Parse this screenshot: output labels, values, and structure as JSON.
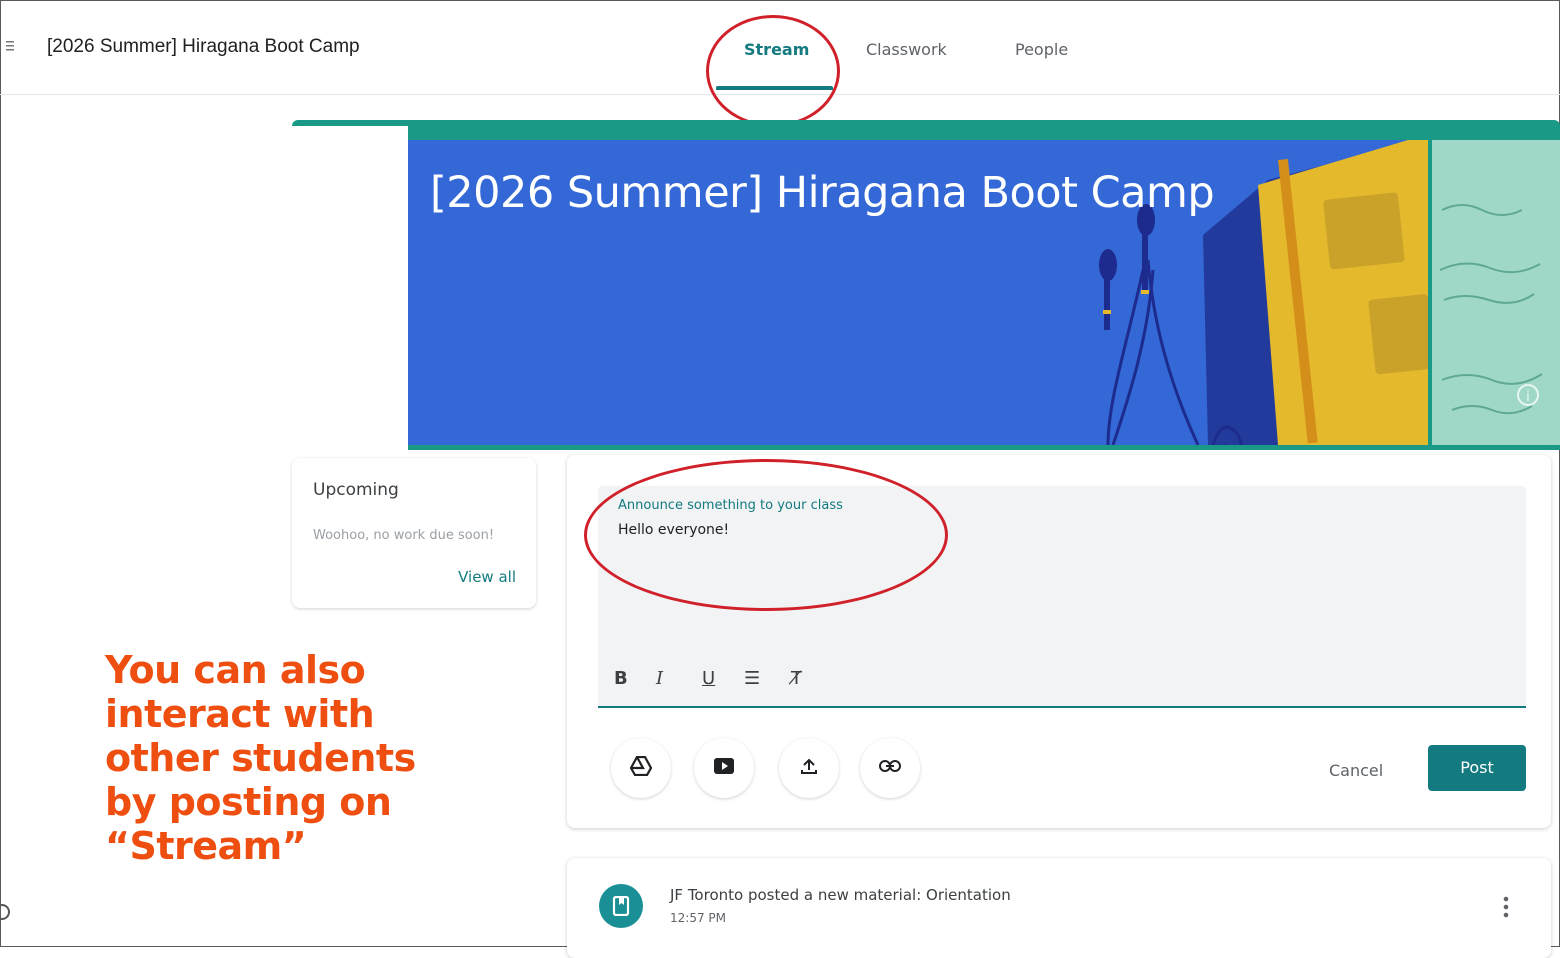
{
  "app": {
    "course_title": "[2026 Summer] Hiragana Boot Camp"
  },
  "tabs": [
    {
      "label": "Stream",
      "active": true
    },
    {
      "label": "Classwork",
      "active": false
    },
    {
      "label": "People",
      "active": false
    }
  ],
  "banner": {
    "title": "[2026 Summer] Hiragana Boot Camp",
    "colors": {
      "primary": "#3368d6",
      "accent": "#1a9a86"
    }
  },
  "upcoming": {
    "title": "Upcoming",
    "empty_text": "Woohoo, no work due soon!",
    "view_all": "View all"
  },
  "composer": {
    "label": "Announce something to your class",
    "value": "Hello everyone!",
    "format_buttons": [
      {
        "name": "bold",
        "glyph": "B"
      },
      {
        "name": "italic",
        "glyph": "I"
      },
      {
        "name": "underline",
        "glyph": "U"
      },
      {
        "name": "bulleted-list",
        "glyph": "☰"
      },
      {
        "name": "clear-formatting",
        "glyph": "T̸"
      }
    ],
    "attach_buttons": [
      "google-drive-icon",
      "youtube-icon",
      "upload-icon",
      "link-icon"
    ],
    "cancel_label": "Cancel",
    "post_label": "Post"
  },
  "stream": [
    {
      "headline": "JF Toronto posted a new material: Orientation",
      "time": "12:57 PM",
      "icon": "material-icon"
    }
  ],
  "callout": {
    "text": "You can also interact with other students by posting on “Stream”",
    "color": "#ee4e10"
  }
}
